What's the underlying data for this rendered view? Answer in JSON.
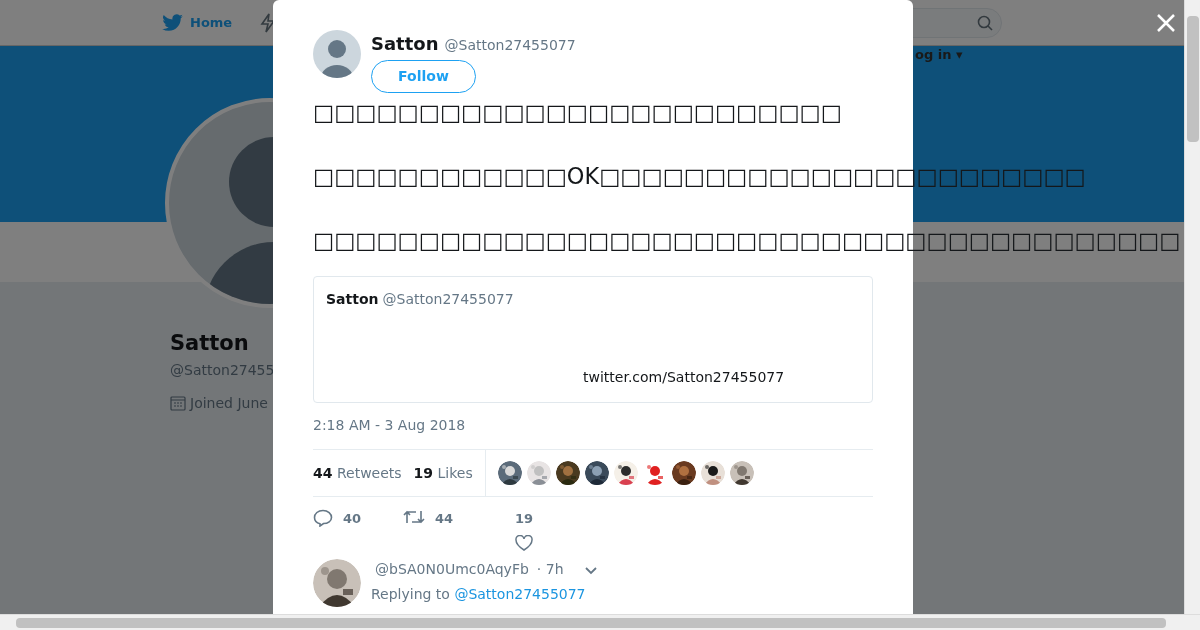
{
  "background": {
    "nav": [
      {
        "label": "Home",
        "selected": true
      }
    ],
    "login": "og in ▾",
    "profile": {
      "name": "Satton",
      "handle": "@Satton27455",
      "joined": "Joined June"
    }
  },
  "tweet": {
    "author": {
      "name": "Satton",
      "handle": "@Satton27455077"
    },
    "follow": "Follow",
    "lines": [
      "□□□□□□□□□□□□□□□□□□□□□□□□□",
      "□□□□□□□□□□□□OK□□□□□□□□□□□□□□□□□□□□□□□",
      "□□□□□□□□□□□□□□□□□□□□□□□□□□□□□□□□□□□□□□□□□"
    ],
    "quote": {
      "name": "Satton",
      "handle": "@Satton27455077",
      "link": "twitter.com/Satton27455077"
    },
    "timestamp": "2:18 AM - 3 Aug 2018",
    "stats": [
      {
        "count": "44",
        "label": "Retweets"
      },
      {
        "count": "19",
        "label": "Likes"
      }
    ],
    "actions": [
      {
        "kind": "reply",
        "count": "40"
      },
      {
        "kind": "retweet",
        "count": "44"
      },
      {
        "kind": "like",
        "count": "19"
      }
    ],
    "reply": {
      "handle": "@bSA0N0Umc0AqyFb",
      "time": "· 7h",
      "replying": "Replying to",
      "to": "@Satton27455077"
    }
  }
}
